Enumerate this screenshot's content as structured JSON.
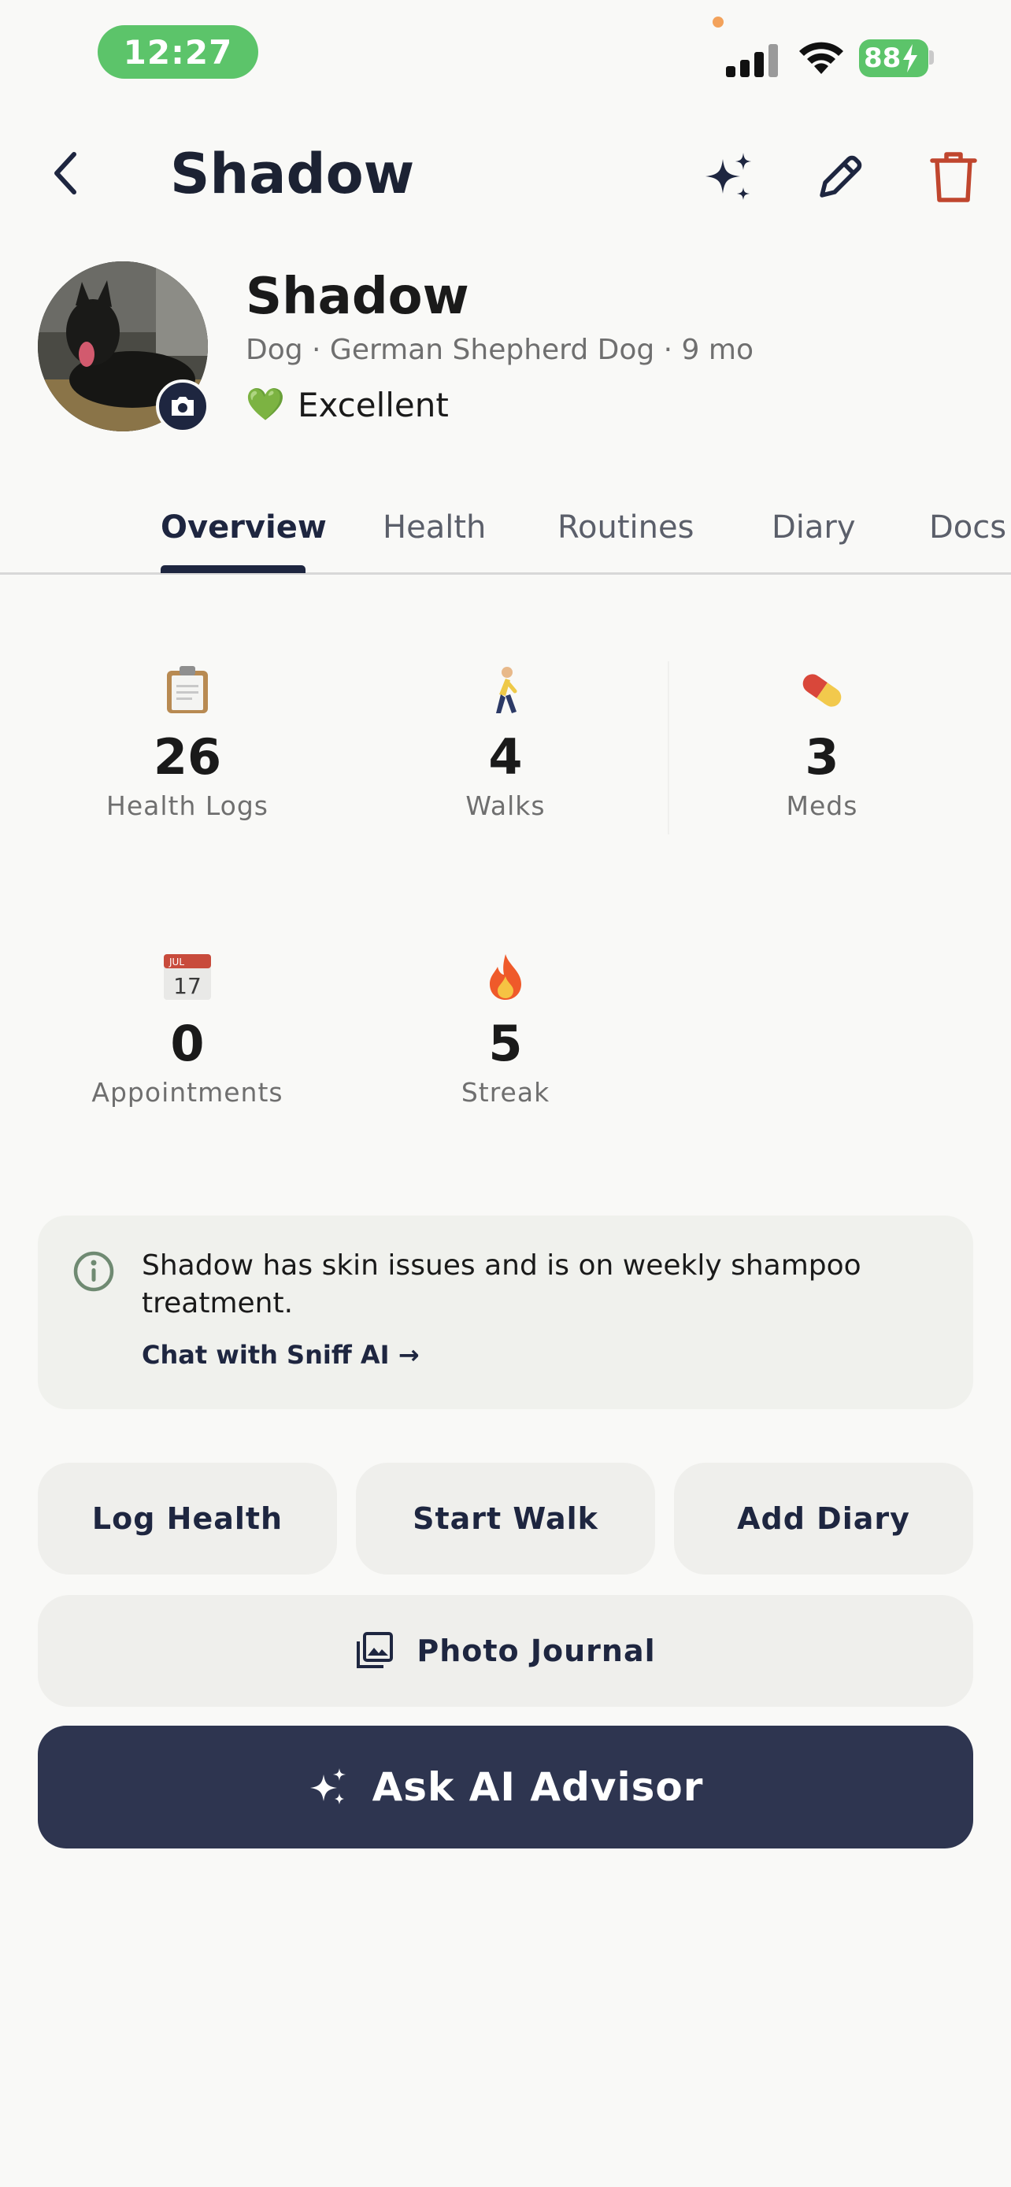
{
  "status_bar": {
    "time": "12:27",
    "battery": "88"
  },
  "header": {
    "title": "Shadow",
    "icons": [
      "back-chevron-icon",
      "sparkle-icon",
      "pencil-icon",
      "trash-icon"
    ]
  },
  "profile": {
    "name": "Shadow",
    "meta": "Dog · German Shepherd Dog · 9 mo",
    "health_icon": "💚",
    "health_status": "Excellent"
  },
  "tabs": [
    {
      "label": "Overview",
      "active": true
    },
    {
      "label": "Health",
      "active": false
    },
    {
      "label": "Routines",
      "active": false
    },
    {
      "label": "Diary",
      "active": false
    },
    {
      "label": "Docs",
      "active": false
    }
  ],
  "stats": [
    {
      "icon": "clipboard-icon",
      "value": "26",
      "label": "Health Logs"
    },
    {
      "icon": "walking-person-icon",
      "value": "4",
      "label": "Walks"
    },
    {
      "icon": "pill-icon",
      "value": "3",
      "label": "Meds"
    },
    {
      "icon": "calendar-icon",
      "calendar_month": "JUL",
      "calendar_day": "17",
      "value": "0",
      "label": "Appointments"
    },
    {
      "icon": "fire-icon",
      "value": "5",
      "label": "Streak"
    }
  ],
  "info_card": {
    "text": "Shadow has skin issues and is on weekly shampoo treatment.",
    "link": "Chat with Sniff AI →"
  },
  "actions": {
    "log_health": "Log Health",
    "start_walk": "Start Walk",
    "add_diary": "Add Diary",
    "photo_journal": "Photo Journal",
    "ask_ai": "Ask AI Advisor"
  },
  "colors": {
    "accent_navy": "#2e3550",
    "status_green": "#5cc46a",
    "delete_red": "#c0462e",
    "background": "#f9f9f7"
  }
}
